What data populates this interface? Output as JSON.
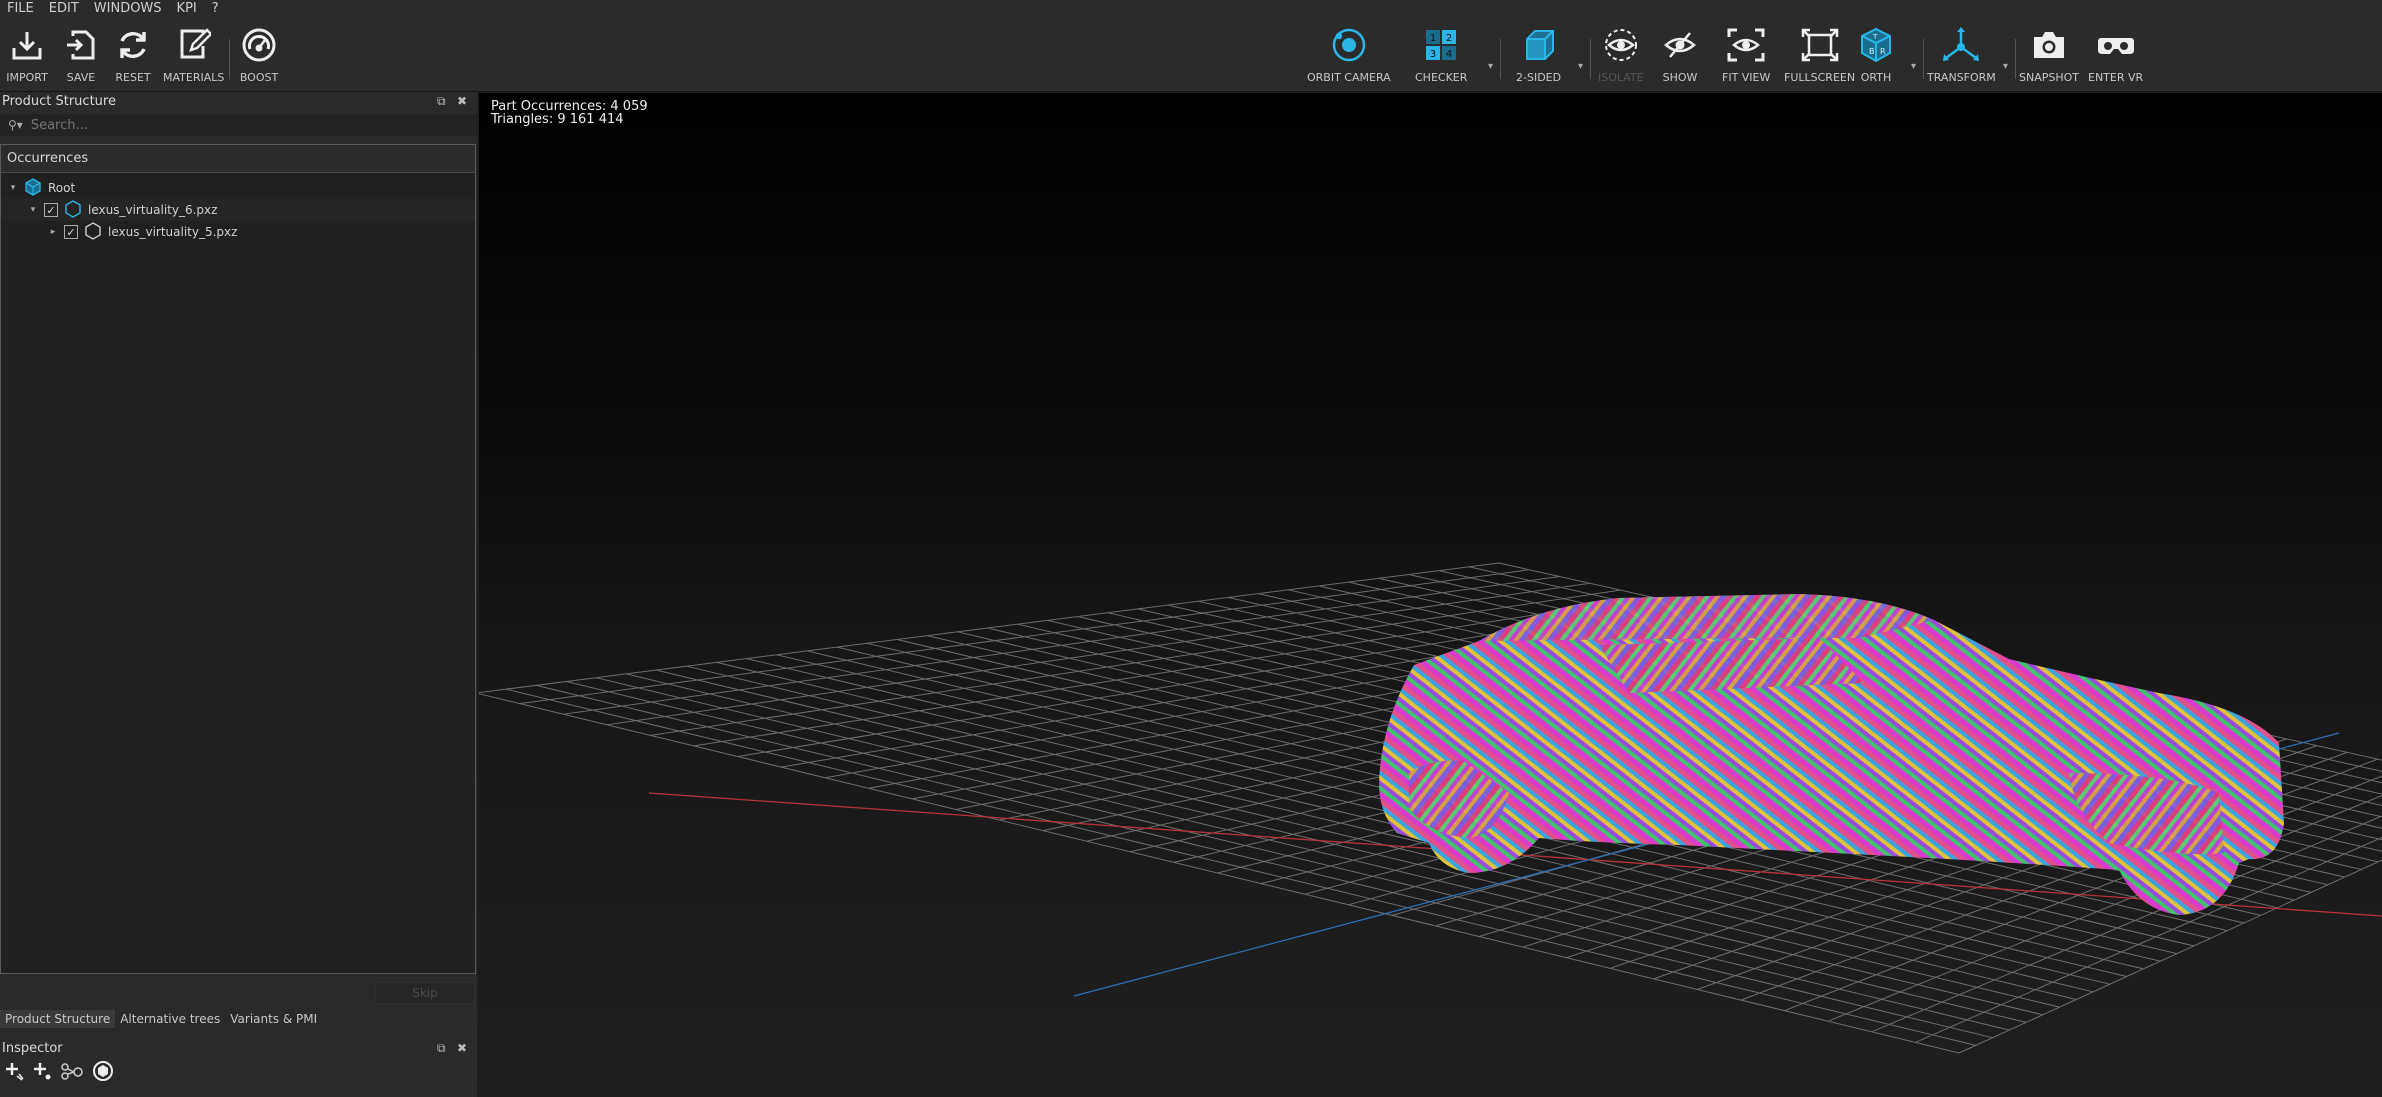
{
  "menu": [
    "FILE",
    "EDIT",
    "WINDOWS",
    "KPI",
    "?"
  ],
  "toolbar": {
    "left": [
      {
        "label": "IMPORT",
        "icon": "import-icon"
      },
      {
        "label": "SAVE",
        "icon": "save-icon"
      },
      {
        "label": "RESET",
        "icon": "reset-icon"
      },
      {
        "label": "MATERIALS",
        "icon": "materials-icon"
      },
      {
        "label": "BOOST",
        "icon": "boost-icon"
      }
    ],
    "right": [
      {
        "label": "ORBIT CAMERA",
        "icon": "orbit-camera-icon"
      },
      {
        "label": "CHECKER",
        "icon": "checker-icon"
      },
      {
        "label": "2-SIDED",
        "icon": "two-sided-icon"
      },
      {
        "label": "ISOLATE",
        "icon": "isolate-icon",
        "disabled": true
      },
      {
        "label": "SHOW",
        "icon": "show-icon"
      },
      {
        "label": "FIT VIEW",
        "icon": "fit-view-icon"
      },
      {
        "label": "FULLSCREEN",
        "icon": "fullscreen-icon"
      },
      {
        "label": "ORTH",
        "icon": "orth-icon"
      },
      {
        "label": "TRANSFORM",
        "icon": "transform-icon"
      },
      {
        "label": "SNAPSHOT",
        "icon": "snapshot-icon"
      },
      {
        "label": "ENTER VR",
        "icon": "vr-icon"
      }
    ],
    "checker_digits": [
      "1",
      "2",
      "3",
      "4"
    ]
  },
  "product_structure": {
    "title": "Product Structure",
    "search_placeholder": "Search...",
    "occurrences_label": "Occurrences",
    "tree": [
      {
        "label": "Root",
        "level": 0
      },
      {
        "label": "lexus_virtuality_6.pxz",
        "level": 1,
        "checked": true
      },
      {
        "label": "lexus_virtuality_5.pxz",
        "level": 2,
        "checked": true
      }
    ],
    "skip_label": "Skip",
    "tabs": [
      "Product Structure",
      "Alternative trees",
      "Variants & PMI"
    ]
  },
  "inspector": {
    "title": "Inspector"
  },
  "viewport": {
    "stats": {
      "part_occurrences": "Part Occurrences: 4 059",
      "triangles": "Triangles: 9 161 414"
    }
  },
  "colors": {
    "accent": "#29b6e8",
    "panel_bg": "#2a2a2a",
    "toolbar_bg": "#2b2b2b",
    "x_axis": "#b8343a",
    "z_axis": "#2d6fb5"
  }
}
